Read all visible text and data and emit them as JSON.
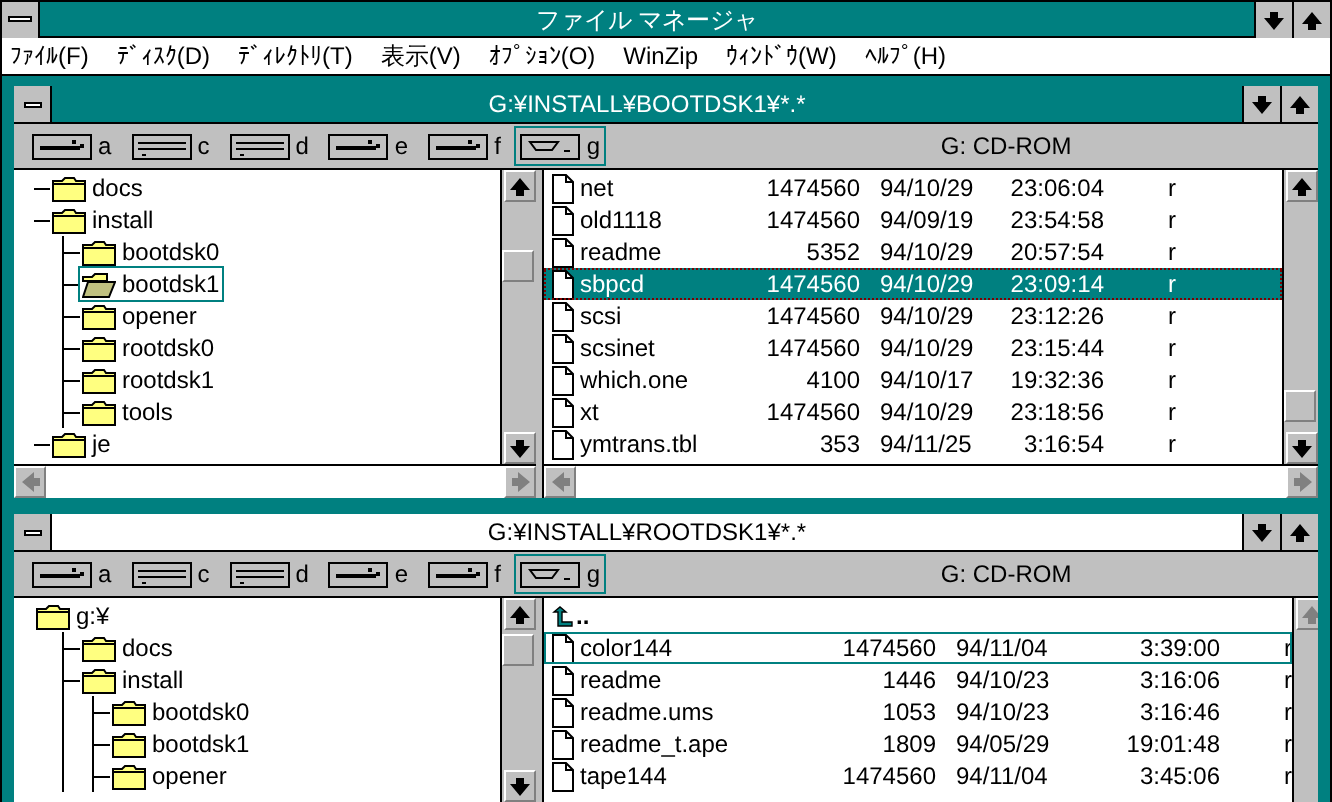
{
  "app": {
    "title": "ファイル マネージャ"
  },
  "menu": [
    "ﾌｧｲﾙ(F)",
    "ﾃﾞｨｽｸ(D)",
    "ﾃﾞｨﾚｸﾄﾘ(T)",
    "表示(V)",
    "ｵﾌﾟｼｮﾝ(O)",
    "WinZip",
    "ｳｨﾝﾄﾞｳ(W)",
    "ﾍﾙﾌﾟ(H)"
  ],
  "windows": [
    {
      "title": "G:¥INSTALL¥BOOTDSK1¥*.*",
      "active": true,
      "drives": [
        {
          "letter": "a",
          "kind": "floppy",
          "selected": false
        },
        {
          "letter": "c",
          "kind": "hard",
          "selected": false
        },
        {
          "letter": "d",
          "kind": "hard",
          "selected": false
        },
        {
          "letter": "e",
          "kind": "floppy",
          "selected": false
        },
        {
          "letter": "f",
          "kind": "floppy",
          "selected": false
        },
        {
          "letter": "g",
          "kind": "cdrom",
          "selected": true
        }
      ],
      "volume": "G: CD-ROM",
      "tree": [
        {
          "name": "docs",
          "selected": false
        },
        {
          "name": "install",
          "selected": false,
          "children": [
            {
              "name": "bootdsk0",
              "selected": false
            },
            {
              "name": "bootdsk1",
              "selected": true
            },
            {
              "name": "opener",
              "selected": false
            },
            {
              "name": "rootdsk0",
              "selected": false
            },
            {
              "name": "rootdsk1",
              "selected": false
            },
            {
              "name": "tools",
              "selected": false
            }
          ]
        },
        {
          "name": "je",
          "selected": false
        }
      ],
      "files": [
        {
          "kind": "file",
          "name": "net",
          "size": "1474560",
          "date": "94/10/29",
          "time": "23:06:04",
          "attr": "r",
          "selected": false,
          "focused": false
        },
        {
          "kind": "file",
          "name": "old1118",
          "size": "1474560",
          "date": "94/09/19",
          "time": "23:54:58",
          "attr": "r",
          "selected": false,
          "focused": false
        },
        {
          "kind": "file",
          "name": "readme",
          "size": "5352",
          "date": "94/10/29",
          "time": "20:57:54",
          "attr": "r",
          "selected": false,
          "focused": false
        },
        {
          "kind": "file",
          "name": "sbpcd",
          "size": "1474560",
          "date": "94/10/29",
          "time": "23:09:14",
          "attr": "r",
          "selected": true,
          "focused": true
        },
        {
          "kind": "file",
          "name": "scsi",
          "size": "1474560",
          "date": "94/10/29",
          "time": "23:12:26",
          "attr": "r",
          "selected": false,
          "focused": false
        },
        {
          "kind": "file",
          "name": "scsinet",
          "size": "1474560",
          "date": "94/10/29",
          "time": "23:15:44",
          "attr": "r",
          "selected": false,
          "focused": false
        },
        {
          "kind": "file",
          "name": "which.one",
          "size": "4100",
          "date": "94/10/17",
          "time": "19:32:36",
          "attr": "r",
          "selected": false,
          "focused": false
        },
        {
          "kind": "file",
          "name": "xt",
          "size": "1474560",
          "date": "94/10/29",
          "time": "23:18:56",
          "attr": "r",
          "selected": false,
          "focused": false
        },
        {
          "kind": "file",
          "name": "ymtrans.tbl",
          "size": "353",
          "date": "94/11/25",
          "time": "3:16:54",
          "attr": "r",
          "selected": false,
          "focused": false
        }
      ]
    },
    {
      "title": "G:¥INSTALL¥ROOTDSK1¥*.*",
      "active": false,
      "drives": [
        {
          "letter": "a",
          "kind": "floppy",
          "selected": false
        },
        {
          "letter": "c",
          "kind": "hard",
          "selected": false
        },
        {
          "letter": "d",
          "kind": "hard",
          "selected": false
        },
        {
          "letter": "e",
          "kind": "floppy",
          "selected": false
        },
        {
          "letter": "f",
          "kind": "floppy",
          "selected": false
        },
        {
          "letter": "g",
          "kind": "cdrom",
          "selected": true
        }
      ],
      "volume": "G: CD-ROM",
      "tree": [
        {
          "name": "g:¥",
          "selected": false,
          "children": [
            {
              "name": "docs",
              "selected": false
            },
            {
              "name": "install",
              "selected": false,
              "children": [
                {
                  "name": "bootdsk0",
                  "selected": false
                },
                {
                  "name": "bootdsk1",
                  "selected": false
                },
                {
                  "name": "opener",
                  "selected": false
                }
              ]
            }
          ]
        }
      ],
      "files": [
        {
          "kind": "parent",
          "name": "..",
          "selected": false,
          "focused": false
        },
        {
          "kind": "file",
          "name": "color144",
          "size": "1474560",
          "date": "94/11/04",
          "time": "3:39:00",
          "attr": "r",
          "selected": false,
          "focused": true
        },
        {
          "kind": "file",
          "name": "readme",
          "size": "1446",
          "date": "94/10/23",
          "time": "3:16:06",
          "attr": "r",
          "selected": false,
          "focused": false
        },
        {
          "kind": "file",
          "name": "readme.ums",
          "size": "1053",
          "date": "94/10/23",
          "time": "3:16:46",
          "attr": "r",
          "selected": false,
          "focused": false
        },
        {
          "kind": "file",
          "name": "readme_t.ape",
          "size": "1809",
          "date": "94/05/29",
          "time": "19:01:48",
          "attr": "r",
          "selected": false,
          "focused": false
        },
        {
          "kind": "file",
          "name": "tape144",
          "size": "1474560",
          "date": "94/11/04",
          "time": "3:45:06",
          "attr": "r",
          "selected": false,
          "focused": false
        }
      ]
    }
  ]
}
